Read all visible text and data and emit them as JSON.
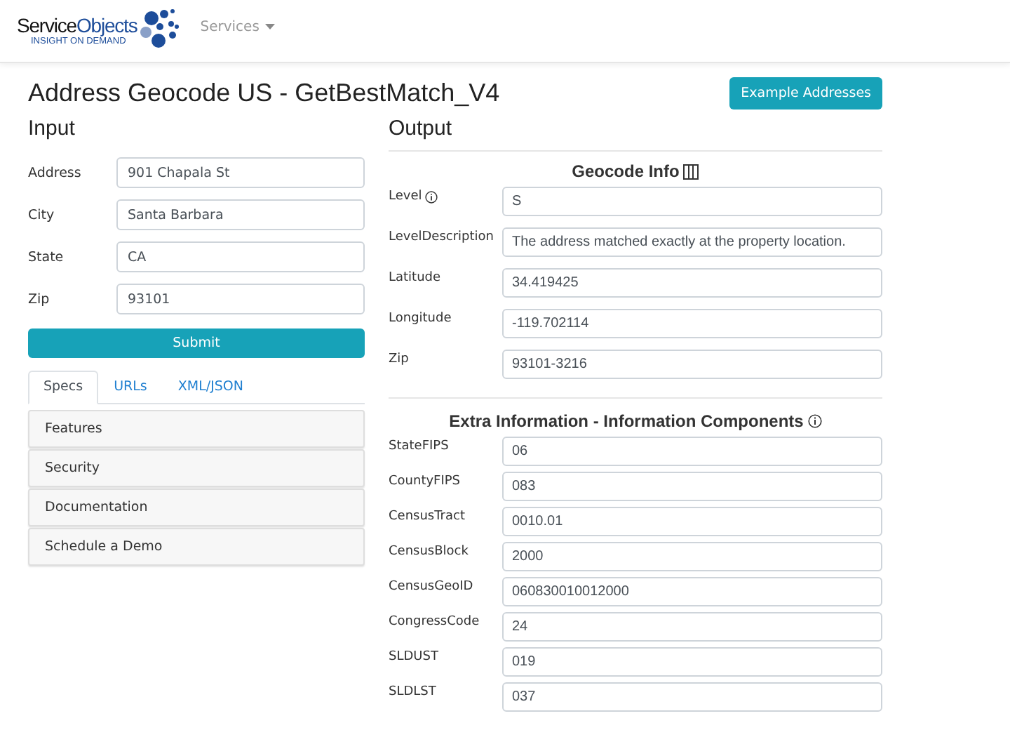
{
  "brand": {
    "name_dark": "Service",
    "name_blue": "Objects",
    "tagline": "INSIGHT ON DEMAND"
  },
  "nav": {
    "menu": "Services"
  },
  "title": "Address Geocode US - GetBestMatch_V4",
  "example_button": "Example Addresses",
  "input": {
    "heading": "Input",
    "fields": [
      {
        "label": "Address",
        "value": "901 Chapala St"
      },
      {
        "label": "City",
        "value": "Santa Barbara"
      },
      {
        "label": "State",
        "value": "CA"
      },
      {
        "label": "Zip",
        "value": "93101"
      }
    ],
    "submit": "Submit",
    "tabs": [
      {
        "label": "Specs",
        "selected": true
      },
      {
        "label": "URLs",
        "selected": false
      },
      {
        "label": "XML/JSON",
        "selected": false
      }
    ],
    "accordion": [
      "Features",
      "Security",
      "Documentation",
      "Schedule a Demo"
    ]
  },
  "output": {
    "heading": "Output",
    "sections": [
      {
        "title": "Geocode Info",
        "rows": [
          {
            "label": "Level",
            "info": true,
            "value": "S"
          },
          {
            "label": "LevelDescription",
            "info": false,
            "value": "The address matched exactly at the property location."
          },
          {
            "label": "Latitude",
            "info": false,
            "value": "34.419425"
          },
          {
            "label": "Longitude",
            "info": false,
            "value": "-119.702114"
          },
          {
            "label": "Zip",
            "info": false,
            "value": "93101-3216"
          }
        ]
      },
      {
        "title": "Extra Information - Information Components",
        "rows": [
          {
            "label": "StateFIPS",
            "info": false,
            "value": "06"
          },
          {
            "label": "CountyFIPS",
            "info": false,
            "value": "083"
          },
          {
            "label": "CensusTract",
            "info": false,
            "value": "0010.01"
          },
          {
            "label": "CensusBlock",
            "info": false,
            "value": "2000"
          },
          {
            "label": "CensusGeoID",
            "info": false,
            "value": "060830010012000"
          },
          {
            "label": "CongressCode",
            "info": false,
            "value": "24"
          },
          {
            "label": "SLDUST",
            "info": false,
            "value": "019"
          },
          {
            "label": "SLDLST",
            "info": false,
            "value": "037"
          }
        ]
      }
    ]
  }
}
